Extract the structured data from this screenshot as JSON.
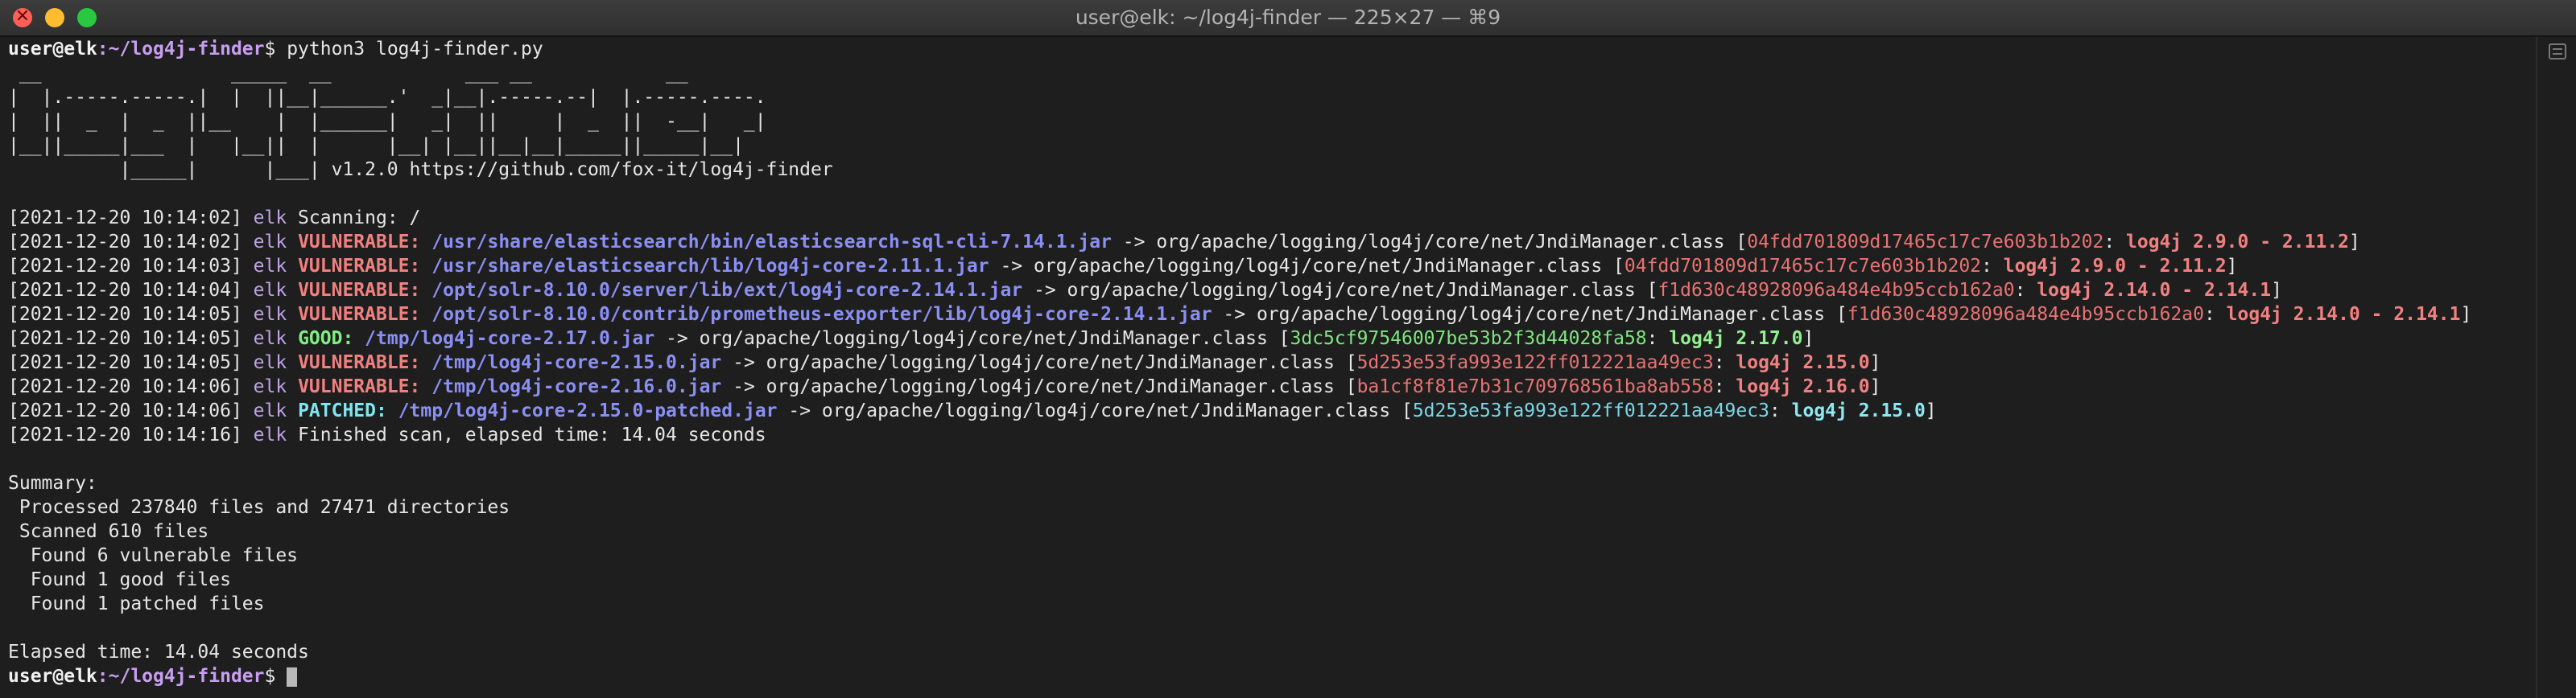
{
  "window": {
    "title": "user@elk: ~/log4j-finder — 225×27 — ⌘9"
  },
  "prompt": {
    "user_host": "user@elk",
    "path": ":~/log4j-finder",
    "symbol": "$",
    "command": " python3 log4j-finder.py"
  },
  "banner": [
    " __                 _____  __            ___ __            __",
    "|  |.-----.-----.|  |  ||__|______.'  _|__|.-----.--|  |.-----.----.",
    "|  ||  _  |  _  ||__    |  |______|   _|  ||     |  _  ||  -__|   _|",
    "|__||_____|___  |   |__||  |      |__| |__||__|__|_____||_____|__|",
    "          |_____|      |___| v1.2.0 https://github.com/fox-it/log4j-finder"
  ],
  "log": [
    {
      "ts": "[2021-12-20 10:14:02]",
      "host": "elk",
      "status": "",
      "path": "",
      "text": " Scanning: /",
      "hash": "",
      "version": "",
      "kind": "info"
    },
    {
      "ts": "[2021-12-20 10:14:02]",
      "host": "elk",
      "status": "VULNERABLE:",
      "path": "/usr/share/elasticsearch/bin/elasticsearch-sql-cli-7.14.1.jar",
      "text": " -> org/apache/logging/log4j/core/net/JndiManager.class [",
      "hash": "04fdd701809d17465c17c7e603b1b202",
      "version": "log4j 2.9.0 - 2.11.2",
      "kind": "vuln"
    },
    {
      "ts": "[2021-12-20 10:14:03]",
      "host": "elk",
      "status": "VULNERABLE:",
      "path": "/usr/share/elasticsearch/lib/log4j-core-2.11.1.jar",
      "text": " -> org/apache/logging/log4j/core/net/JndiManager.class [",
      "hash": "04fdd701809d17465c17c7e603b1b202",
      "version": "log4j 2.9.0 - 2.11.2",
      "kind": "vuln"
    },
    {
      "ts": "[2021-12-20 10:14:04]",
      "host": "elk",
      "status": "VULNERABLE:",
      "path": "/opt/solr-8.10.0/server/lib/ext/log4j-core-2.14.1.jar",
      "text": " -> org/apache/logging/log4j/core/net/JndiManager.class [",
      "hash": "f1d630c48928096a484e4b95ccb162a0",
      "version": "log4j 2.14.0 - 2.14.1",
      "kind": "vuln"
    },
    {
      "ts": "[2021-12-20 10:14:05]",
      "host": "elk",
      "status": "VULNERABLE:",
      "path": "/opt/solr-8.10.0/contrib/prometheus-exporter/lib/log4j-core-2.14.1.jar",
      "text": " -> org/apache/logging/log4j/core/net/JndiManager.class [",
      "hash": "f1d630c48928096a484e4b95ccb162a0",
      "version": "log4j 2.14.0 - 2.14.1",
      "kind": "vuln"
    },
    {
      "ts": "[2021-12-20 10:14:05]",
      "host": "elk",
      "status": "GOOD:",
      "path": "/tmp/log4j-core-2.17.0.jar",
      "text": " -> org/apache/logging/log4j/core/net/JndiManager.class [",
      "hash": "3dc5cf97546007be53b2f3d44028fa58",
      "version": "log4j 2.17.0",
      "kind": "good"
    },
    {
      "ts": "[2021-12-20 10:14:05]",
      "host": "elk",
      "status": "VULNERABLE:",
      "path": "/tmp/log4j-core-2.15.0.jar",
      "text": " -> org/apache/logging/log4j/core/net/JndiManager.class [",
      "hash": "5d253e53fa993e122ff012221aa49ec3",
      "version": "log4j 2.15.0",
      "kind": "vuln"
    },
    {
      "ts": "[2021-12-20 10:14:06]",
      "host": "elk",
      "status": "VULNERABLE:",
      "path": "/tmp/log4j-core-2.16.0.jar",
      "text": " -> org/apache/logging/log4j/core/net/JndiManager.class [",
      "hash": "ba1cf8f81e7b31c709768561ba8ab558",
      "version": "log4j 2.16.0",
      "kind": "vuln"
    },
    {
      "ts": "[2021-12-20 10:14:06]",
      "host": "elk",
      "status": "PATCHED:",
      "path": "/tmp/log4j-core-2.15.0-patched.jar",
      "text": " -> org/apache/logging/log4j/core/net/JndiManager.class [",
      "hash": "5d253e53fa993e122ff012221aa49ec3",
      "version": "log4j 2.15.0",
      "kind": "patched"
    },
    {
      "ts": "[2021-12-20 10:14:16]",
      "host": "elk",
      "status": "",
      "path": "",
      "text": " Finished scan, elapsed time: 14.04 seconds",
      "hash": "",
      "version": "",
      "kind": "info"
    }
  ],
  "summary": {
    "heading": "Summary:",
    "processed": " Processed 237840 files and 27471 directories",
    "scanned": " Scanned 610 files",
    "vulnerable": "  Found 6 vulnerable files",
    "good": "  Found 1 good files",
    "patched": "  Found 1 patched files",
    "elapsed": "Elapsed time: 14.04 seconds"
  },
  "colors": {
    "background": "#1e1e1e",
    "vulnerable": "#f28080",
    "good": "#7ff07f",
    "patched": "#7fe6ef",
    "path": "#8a8ff5",
    "host": "#bfa3e6",
    "prompt_path": "#c89ff0"
  },
  "icons": [
    "close-icon",
    "minimize-icon",
    "zoom-icon",
    "scrollbar-marks-icon"
  ]
}
